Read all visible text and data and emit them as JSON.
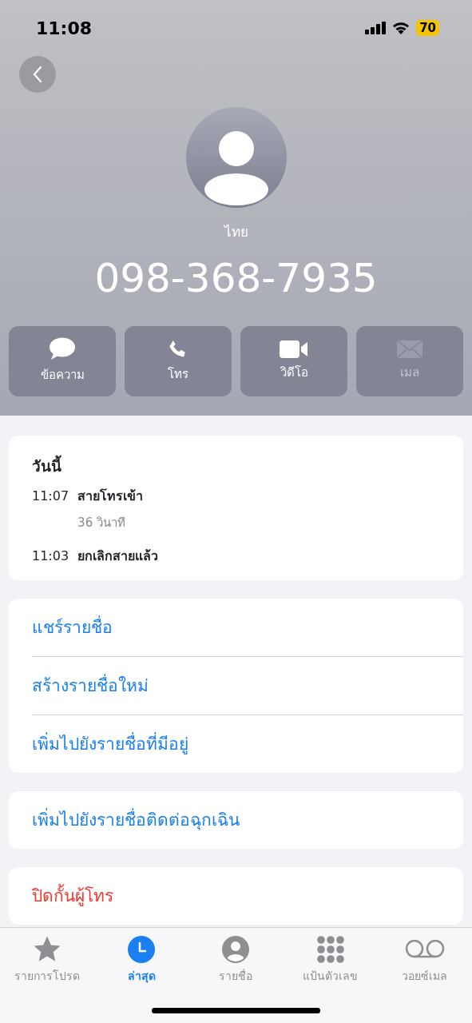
{
  "status_bar": {
    "time": "11:08",
    "battery": "70"
  },
  "contact": {
    "label": "ไทย",
    "phone": "098-368-7935"
  },
  "actions": [
    {
      "kind": "message",
      "label": "ข้อความ",
      "disabled": false
    },
    {
      "kind": "phone",
      "label": "โทร",
      "disabled": false
    },
    {
      "kind": "video",
      "label": "วิดีโอ",
      "disabled": false
    },
    {
      "kind": "mail",
      "label": "เมล",
      "disabled": true
    }
  ],
  "history": {
    "title": "วันนี้",
    "calls": [
      {
        "time": "11:07",
        "type": "สายโทรเข้า",
        "duration": "36 วินาที"
      },
      {
        "time": "11:03",
        "type": "ยกเลิกสายแล้ว"
      }
    ]
  },
  "option_groups": [
    [
      {
        "label": "แชร์รายชื่อ",
        "destructive": false
      },
      {
        "label": "สร้างรายชื่อใหม่",
        "destructive": false
      },
      {
        "label": "เพิ่มไปยังรายชื่อที่มีอยู่",
        "destructive": false
      }
    ],
    [
      {
        "label": "เพิ่มไปยังรายชื่อติดต่อฉุกเฉิน",
        "destructive": false
      }
    ],
    [
      {
        "label": "ปิดกั้นผู้โทร",
        "destructive": true
      }
    ]
  ],
  "tab_bar": [
    {
      "kind": "favorites",
      "label": "รายการโปรด",
      "selected": false
    },
    {
      "kind": "recents",
      "label": "ล่าสุด",
      "selected": true
    },
    {
      "kind": "contacts",
      "label": "รายชื่อ",
      "selected": false
    },
    {
      "kind": "keypad",
      "label": "แป้นตัวเลข",
      "selected": false
    },
    {
      "kind": "voicemail",
      "label": "วอยซ์เมล",
      "selected": false
    }
  ]
}
